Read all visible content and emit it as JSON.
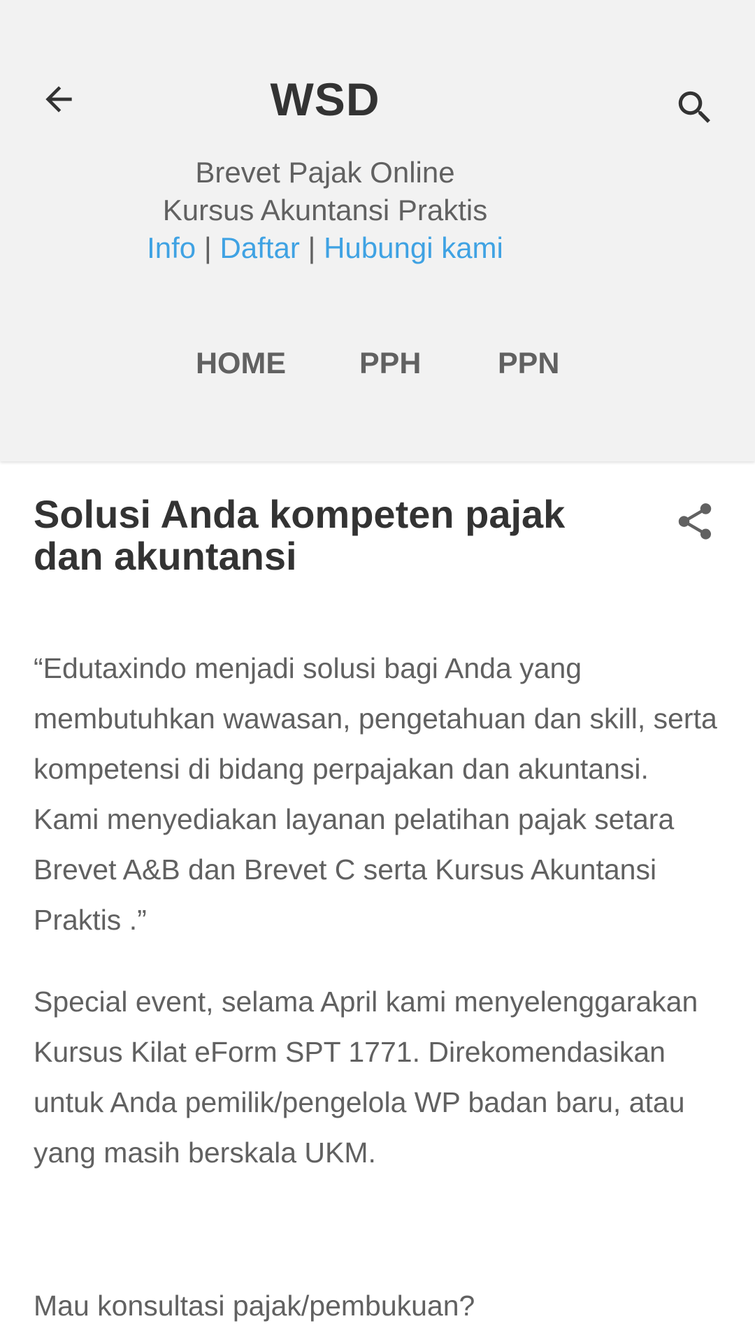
{
  "header": {
    "site_title": "WSD",
    "tagline_line1": "Brevet Pajak Online",
    "tagline_line2": "Kursus Akuntansi Praktis",
    "links": [
      "Info",
      "Daftar",
      "Hubungi kami"
    ],
    "separator": "|",
    "link_color": "#3fa2e3",
    "background": "#f2f2f2"
  },
  "icons": {
    "back": "arrow-left",
    "search": "magnifier",
    "share": "share"
  },
  "nav": {
    "items": [
      "HOME",
      "PPH",
      "PPN"
    ]
  },
  "post": {
    "title": "Solusi Anda kompeten pajak dan akuntansi",
    "paragraph1": "“Edutaxindo menjadi solusi bagi Anda yang membutuhkan wawasan, pengetahuan dan skill, serta kompetensi di bidang perpajakan dan akuntansi. Kami menyediakan layanan pelatihan pajak setara Brevet A&B dan Brevet C serta Kursus Akuntansi Praktis .”",
    "paragraph2": "Special event, selama April kami menyelenggarakan Kursus Kilat eForm SPT 1771. Direkomendasikan untuk Anda pemilik/pengelola WP badan baru, atau yang masih berskala UKM.",
    "paragraph3": "Mau konsultasi pajak/pembukuan?"
  }
}
